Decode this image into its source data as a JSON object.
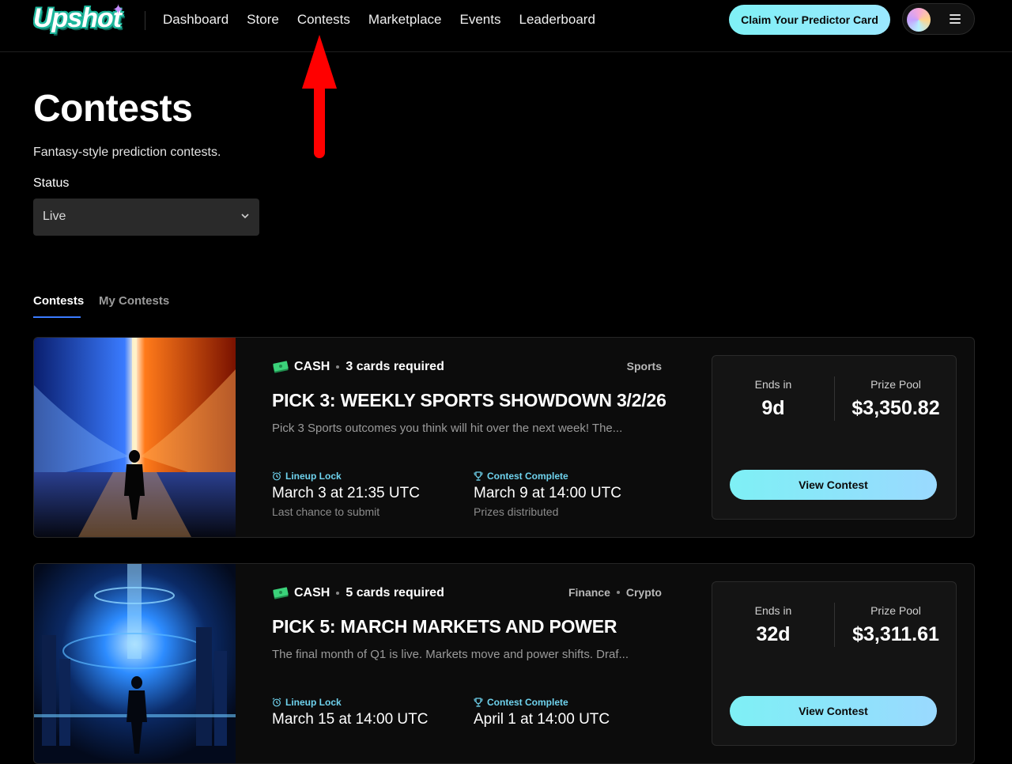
{
  "nav": {
    "logo": "Upshot",
    "links": [
      "Dashboard",
      "Store",
      "Contests",
      "Marketplace",
      "Events",
      "Leaderboard"
    ],
    "claim_label": "Claim Your Predictor Card"
  },
  "header": {
    "title": "Contests",
    "subtitle": "Fantasy-style prediction contests.",
    "status_label": "Status",
    "status_value": "Live"
  },
  "tabs": {
    "active": "Contests",
    "inactive": "My Contests"
  },
  "contests": [
    {
      "currency": "CASH",
      "cards": "3 cards required",
      "categories": [
        "Sports"
      ],
      "title": "PICK 3: WEEKLY SPORTS SHOWDOWN 3/2/26",
      "description": "Pick 3 Sports outcomes you think will hit over the next week! The...",
      "lock_label": "Lineup Lock",
      "lock_date": "March 3 at 21:35 UTC",
      "lock_sub": "Last chance to submit",
      "complete_label": "Contest Complete",
      "complete_date": "March 9 at 14:00 UTC",
      "complete_sub": "Prizes distributed",
      "ends_label": "Ends in",
      "ends_value": "9d",
      "pool_label": "Prize Pool",
      "pool_value": "$3,350.82",
      "button": "View Contest"
    },
    {
      "currency": "CASH",
      "cards": "5 cards required",
      "categories": [
        "Finance",
        "Crypto"
      ],
      "title": "PICK 5: MARCH MARKETS AND POWER",
      "description": "The final month of Q1 is live. Markets move and power shifts. Draf...",
      "lock_label": "Lineup Lock",
      "lock_date": "March 15 at 14:00 UTC",
      "lock_sub": "",
      "complete_label": "Contest Complete",
      "complete_date": "April 1 at 14:00 UTC",
      "complete_sub": "",
      "ends_label": "Ends in",
      "ends_value": "32d",
      "pool_label": "Prize Pool",
      "pool_value": "$3,311.61",
      "button": "View Contest"
    }
  ],
  "colors": {
    "accent_cyan": "#7ff0f5",
    "annotation_arrow": "#ff0000",
    "tab_underline": "#3a7bff",
    "date_label": "#6fd3ee"
  }
}
